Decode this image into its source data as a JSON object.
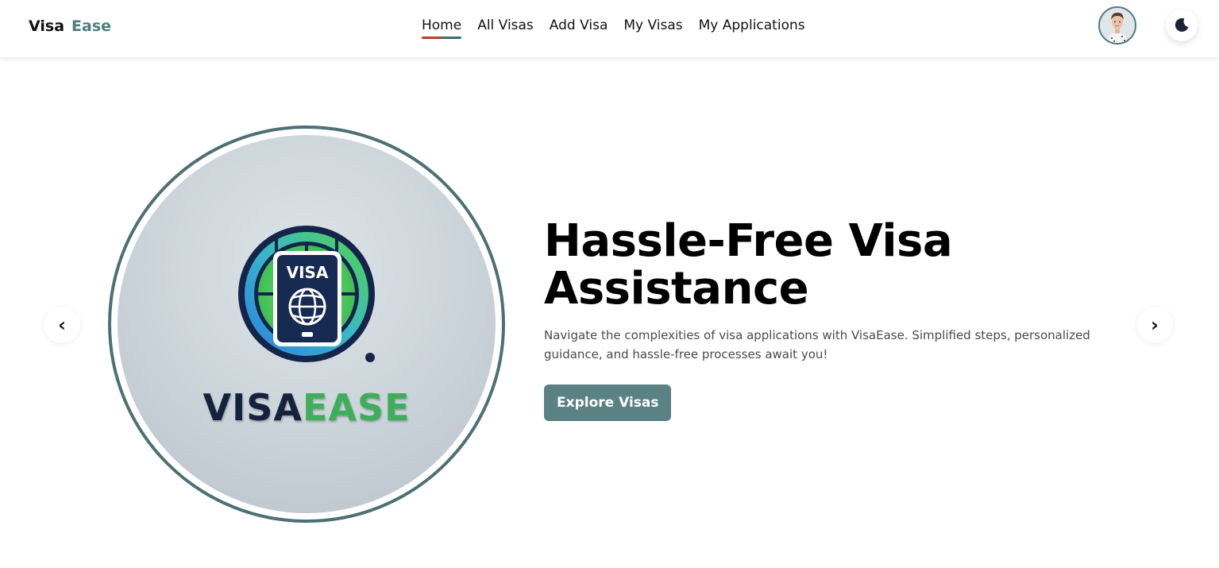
{
  "navbar": {
    "brand_part1": "Visa",
    "brand_part2": "Ease",
    "links": [
      {
        "label": "Home",
        "active": true
      },
      {
        "label": "All Visas",
        "active": false
      },
      {
        "label": "Add Visa",
        "active": false
      },
      {
        "label": "My Visas",
        "active": false
      },
      {
        "label": "My Applications",
        "active": false
      }
    ],
    "avatar_icon": "user-avatar",
    "theme_toggle_icon": "moon-icon"
  },
  "hero": {
    "logo_badge_text": "VISA",
    "logo_word_part1": "VISA",
    "logo_word_part2": "EASE",
    "title": "Hassle-Free Visa Assistance",
    "description": "Navigate the complexities of visa applications with VisaEase. Simplified steps, personalized guidance, and hassle-free processes await you!",
    "cta_label": "Explore Visas",
    "prev_arrow": "‹",
    "next_arrow": "›"
  },
  "colors": {
    "accent": "#5a8184",
    "brand_teal": "#4d7c80",
    "active_underline_red": "#c0392b",
    "logo_navy": "#14223f",
    "logo_green": "#3fae5a"
  }
}
